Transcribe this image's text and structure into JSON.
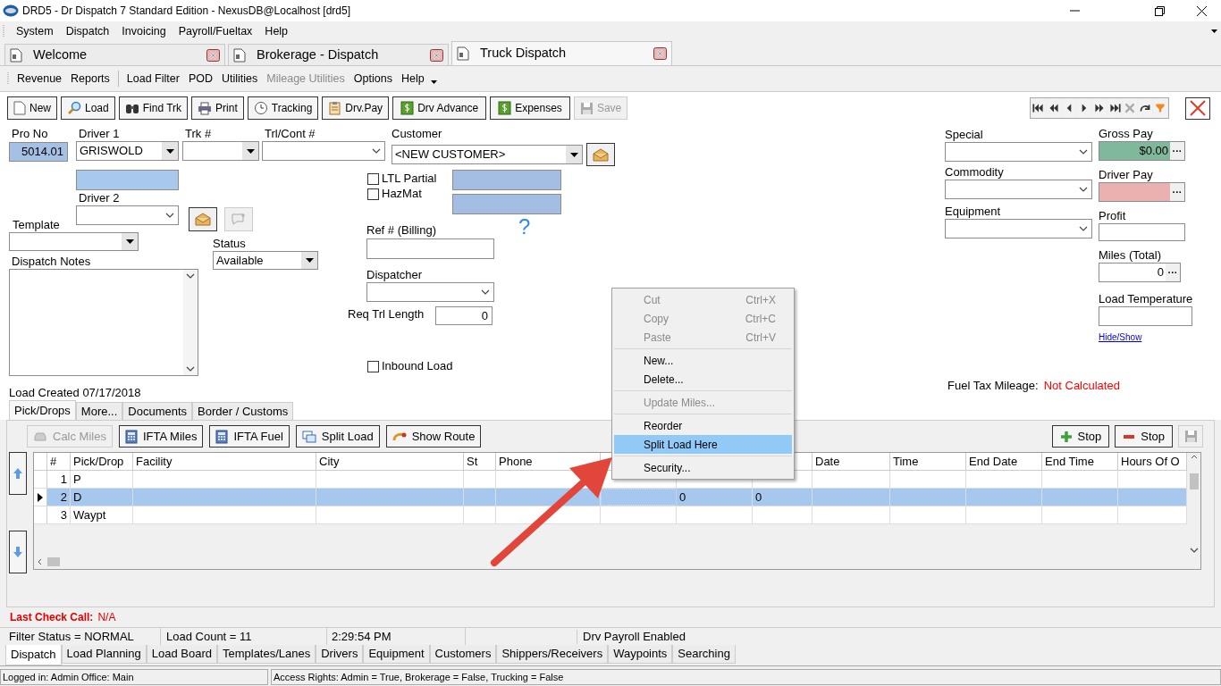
{
  "window": {
    "title": "DRD5 - Dr Dispatch 7 Standard Edition - NexusDB@Localhost [drd5]"
  },
  "menu": [
    "System",
    "Dispatch",
    "Invoicing",
    "Payroll/Fueltax",
    "Help"
  ],
  "doc_tabs": [
    {
      "label": "Welcome",
      "selected": false
    },
    {
      "label": "Brokerage - Dispatch",
      "selected": false
    },
    {
      "label": "Truck Dispatch",
      "selected": true
    }
  ],
  "sub_menu": [
    {
      "label": "Revenue",
      "disabled": false
    },
    {
      "label": "Reports",
      "disabled": false
    },
    {
      "label": "Load Filter",
      "disabled": false
    },
    {
      "label": "POD",
      "disabled": false
    },
    {
      "label": "Utilities",
      "disabled": false
    },
    {
      "label": "Mileage Utilities",
      "disabled": true
    },
    {
      "label": "Options",
      "disabled": false
    },
    {
      "label": "Help",
      "disabled": false
    }
  ],
  "toolbar": [
    {
      "label": "New",
      "disabled": false
    },
    {
      "label": "Load",
      "disabled": false
    },
    {
      "label": "Find Trk",
      "disabled": false
    },
    {
      "label": "Print",
      "disabled": false
    },
    {
      "label": "Tracking",
      "disabled": false
    },
    {
      "label": "Drv.Pay",
      "disabled": false
    },
    {
      "label": "Drv Advance",
      "disabled": false
    },
    {
      "label": "Expenses",
      "disabled": false
    },
    {
      "label": "Save",
      "disabled": true
    }
  ],
  "form": {
    "pro_no": {
      "label": "Pro No",
      "value": "5014.01"
    },
    "driver1": {
      "label": "Driver 1",
      "value": "GRISWOLD"
    },
    "trk": {
      "label": "Trk #"
    },
    "trl": {
      "label": "Trl/Cont #"
    },
    "customer": {
      "label": "Customer",
      "value": "<NEW CUSTOMER>"
    },
    "driver2": {
      "label": "Driver 2"
    },
    "template": {
      "label": "Template"
    },
    "status": {
      "label": "Status",
      "value": "Available"
    },
    "dispatch_notes": {
      "label": "Dispatch Notes"
    },
    "load_created": "Load Created 07/17/2018",
    "ltl_partial": {
      "label": "LTL Partial",
      "checked": false
    },
    "hazmat": {
      "label": "HazMat",
      "checked": false
    },
    "help_glyph": "?",
    "ref": {
      "label": "Ref # (Billing)"
    },
    "dispatcher": {
      "label": "Dispatcher"
    },
    "req_trl_length": {
      "label": "Req Trl Length",
      "value": "0"
    },
    "inbound_load": {
      "label": "Inbound Load",
      "checked": false
    },
    "special": {
      "label": "Special"
    },
    "commodity": {
      "label": "Commodity"
    },
    "equipment": {
      "label": "Equipment"
    },
    "gross_pay": {
      "label": "Gross Pay",
      "value": "$0.00",
      "button": "···"
    },
    "driver_pay": {
      "label": "Driver Pay",
      "button": "···"
    },
    "profit": {
      "label": "Profit"
    },
    "miles_total": {
      "label": "Miles (Total)",
      "value": "0",
      "button": "···"
    },
    "load_temperature": {
      "label": "Load Temperature"
    },
    "hide_show": "Hide/Show",
    "fuel_tax_mileage": {
      "label": "Fuel Tax Mileage:",
      "value": "Not Calculated"
    }
  },
  "inner_tabs": [
    {
      "label": "Pick/Drops",
      "selected": true
    },
    {
      "label": "More...",
      "selected": false
    },
    {
      "label": "Documents",
      "selected": false
    },
    {
      "label": "Border / Customs",
      "selected": false
    }
  ],
  "grid_toolbar": [
    {
      "label": "Calc Miles",
      "disabled": true
    },
    {
      "label": "IFTA Miles",
      "disabled": false
    },
    {
      "label": "IFTA Fuel",
      "disabled": false
    },
    {
      "label": "Split Load",
      "disabled": false
    },
    {
      "label": "Show Route",
      "disabled": false
    }
  ],
  "stop_buttons": [
    {
      "label": "Stop",
      "kind": "add"
    },
    {
      "label": "Stop",
      "kind": "remove"
    }
  ],
  "table": {
    "columns": [
      "#",
      "Pick/Drop",
      "Facility",
      "City",
      "St",
      "Phone",
      null,
      null,
      null,
      "Date",
      "Time",
      "End Date",
      "End Time",
      "Hours Of O"
    ],
    "rows": [
      {
        "selected": false,
        "cells": [
          "1",
          "P"
        ]
      },
      {
        "selected": true,
        "cells": [
          "2",
          "D",
          null,
          null,
          null,
          null,
          null,
          "0",
          "0"
        ]
      },
      {
        "selected": false,
        "cells": [
          "3",
          "Waypt"
        ]
      }
    ]
  },
  "context_menu": [
    [
      {
        "label": "Cut",
        "shortcut": "Ctrl+X",
        "disabled": true,
        "selected": false
      },
      {
        "label": "Copy",
        "shortcut": "Ctrl+C",
        "disabled": true,
        "selected": false
      },
      {
        "label": "Paste",
        "shortcut": "Ctrl+V",
        "disabled": true,
        "selected": false
      }
    ],
    [
      {
        "label": "New...",
        "disabled": false,
        "selected": false
      },
      {
        "label": "Delete...",
        "disabled": false,
        "selected": false
      }
    ],
    [
      {
        "label": "Update Miles...",
        "disabled": true,
        "selected": false
      }
    ],
    [
      {
        "label": "Reorder",
        "disabled": false,
        "selected": false
      },
      {
        "label": "Split Load Here",
        "disabled": false,
        "selected": true
      }
    ],
    [
      {
        "label": "Security...",
        "disabled": false,
        "selected": false
      }
    ]
  ],
  "last_check_call": {
    "label": "Last Check Call:",
    "value": "N/A"
  },
  "status_bar": {
    "filter_status": "Filter Status = NORMAL",
    "load_count": "Load Count = 11",
    "time": "2:29:54 PM",
    "payroll": "Drv Payroll Enabled"
  },
  "bottom_tabs": [
    {
      "label": "Dispatch",
      "selected": true
    },
    {
      "label": "Load Planning",
      "selected": false
    },
    {
      "label": "Load Board",
      "selected": false
    },
    {
      "label": "Templates/Lanes",
      "selected": false
    },
    {
      "label": "Drivers",
      "selected": false
    },
    {
      "label": "Equipment",
      "selected": false
    },
    {
      "label": "Customers",
      "selected": false
    },
    {
      "label": "Shippers/Receivers",
      "selected": false
    },
    {
      "label": "Waypoints",
      "selected": false
    },
    {
      "label": "Searching",
      "selected": false
    }
  ],
  "footer": {
    "logged_in": "Logged in: Admin Office: Main",
    "access_rights": "Access Rights: Admin = True, Brokerage = False, Trucking = False"
  }
}
